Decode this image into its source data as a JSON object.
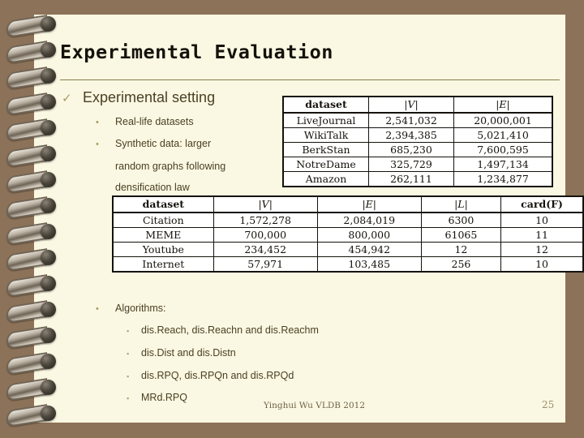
{
  "slide": {
    "title": "Experimental Evaluation",
    "page_number": "25",
    "footer_author": "Yinghui Wu VLDB 2012",
    "colors": {
      "page_background": "#faf8e2",
      "frame": "#8c7258",
      "title_text": "#15120c",
      "body_text": "#4a3f23",
      "bullet": "#a99a62",
      "rule": "#8a7b4e"
    }
  },
  "outline": {
    "level1": {
      "bullet_glyph": "✓",
      "label": "Experimental setting"
    },
    "level2": [
      {
        "bullet_glyph": "•",
        "label": "Real-life datasets"
      },
      {
        "bullet_glyph": "•",
        "label": "Synthetic data: larger"
      }
    ],
    "level2_continuation": [
      "random graphs following",
      "densification law"
    ],
    "algorithms": {
      "bullet_glyph": "•",
      "label": "Algorithms:",
      "items": [
        {
          "bullet_glyph": "▪",
          "label": "dis.Reach, dis.Reachn and dis.Reachm"
        },
        {
          "bullet_glyph": "▪",
          "label": "dis.Dist and dis.Distn"
        },
        {
          "bullet_glyph": "▪",
          "label": "dis.RPQ, dis.RPQn and dis.RPQd"
        },
        {
          "bullet_glyph": "▪",
          "label": "MRd.RPQ"
        }
      ]
    }
  },
  "table_real_life": {
    "headers": [
      "dataset",
      "|V|",
      "|E|"
    ],
    "rows": [
      [
        "LiveJournal",
        "2,541,032",
        "20,000,001"
      ],
      [
        "WikiTalk",
        "2,394,385",
        "5,021,410"
      ],
      [
        "BerkStan",
        "685,230",
        "7,600,595"
      ],
      [
        "NotreDame",
        "325,729",
        "1,497,134"
      ],
      [
        "Amazon",
        "262,111",
        "1,234,877"
      ]
    ]
  },
  "table_synthetic": {
    "headers": [
      "dataset",
      "|V|",
      "|E|",
      "|L|",
      "card(F)"
    ],
    "rows": [
      [
        "Citation",
        "1,572,278",
        "2,084,019",
        "6300",
        "10"
      ],
      [
        "MEME",
        "700,000",
        "800,000",
        "61065",
        "11"
      ],
      [
        "Youtube",
        "234,452",
        "454,942",
        "12",
        "12"
      ],
      [
        "Internet",
        "57,971",
        "103,485",
        "256",
        "10"
      ]
    ]
  }
}
